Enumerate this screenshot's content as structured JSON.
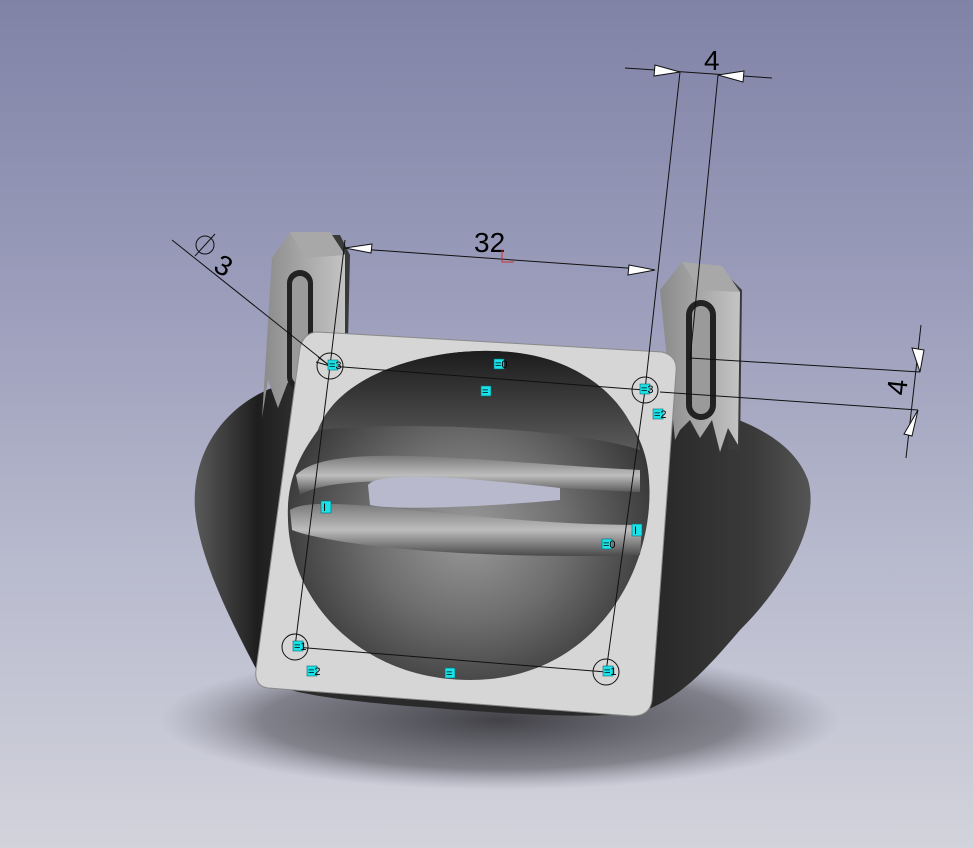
{
  "viewport": {
    "background_top": "#8083a6",
    "background_bottom": "#d3d3dc"
  },
  "model": {
    "face_color": "#d6d6d6",
    "body_color": "#3c3c3c",
    "constraint_badge_color": "#19e3e8"
  },
  "dimensions": {
    "hole_diameter": "3",
    "hole_spacing": "32",
    "edge_offset_top": "4",
    "edge_offset_right": "4"
  },
  "constraints": {
    "top_left_hole": "=3",
    "top_mid": "=0",
    "top_mid_2": "=",
    "top_right_hole": "=3",
    "right_upper": "=2",
    "left_mid": "I",
    "right_mid_vertical": "I",
    "right_mid_eq": "=0",
    "bottom_left_hole": "=1",
    "bottom_left_tag": "=2",
    "bottom_mid": "=",
    "bottom_right_hole": "=1"
  }
}
